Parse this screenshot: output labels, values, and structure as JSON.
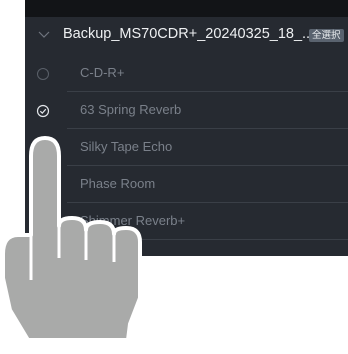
{
  "group": {
    "title": "Backup_MS70CDR+_20240325_18_...",
    "select_all_label": "全選択"
  },
  "patches": [
    {
      "name": "C-D-R+",
      "checked": false
    },
    {
      "name": "63 Spring Reverb",
      "checked": true
    },
    {
      "name": "Silky Tape Echo",
      "checked": false
    },
    {
      "name": "Phase Room",
      "checked": false
    },
    {
      "name": "Shimmer Reverb+",
      "checked": false
    }
  ],
  "icons": {
    "collapse": "chevron-down-icon",
    "unchecked": "circle-outline-icon",
    "checked": "check-circle-icon",
    "pointer": "tap-hand-icon"
  },
  "colors": {
    "panel": "#262a31",
    "topbar": "#121417",
    "hand": "#a9aaa9",
    "badge": "#5a636f"
  }
}
